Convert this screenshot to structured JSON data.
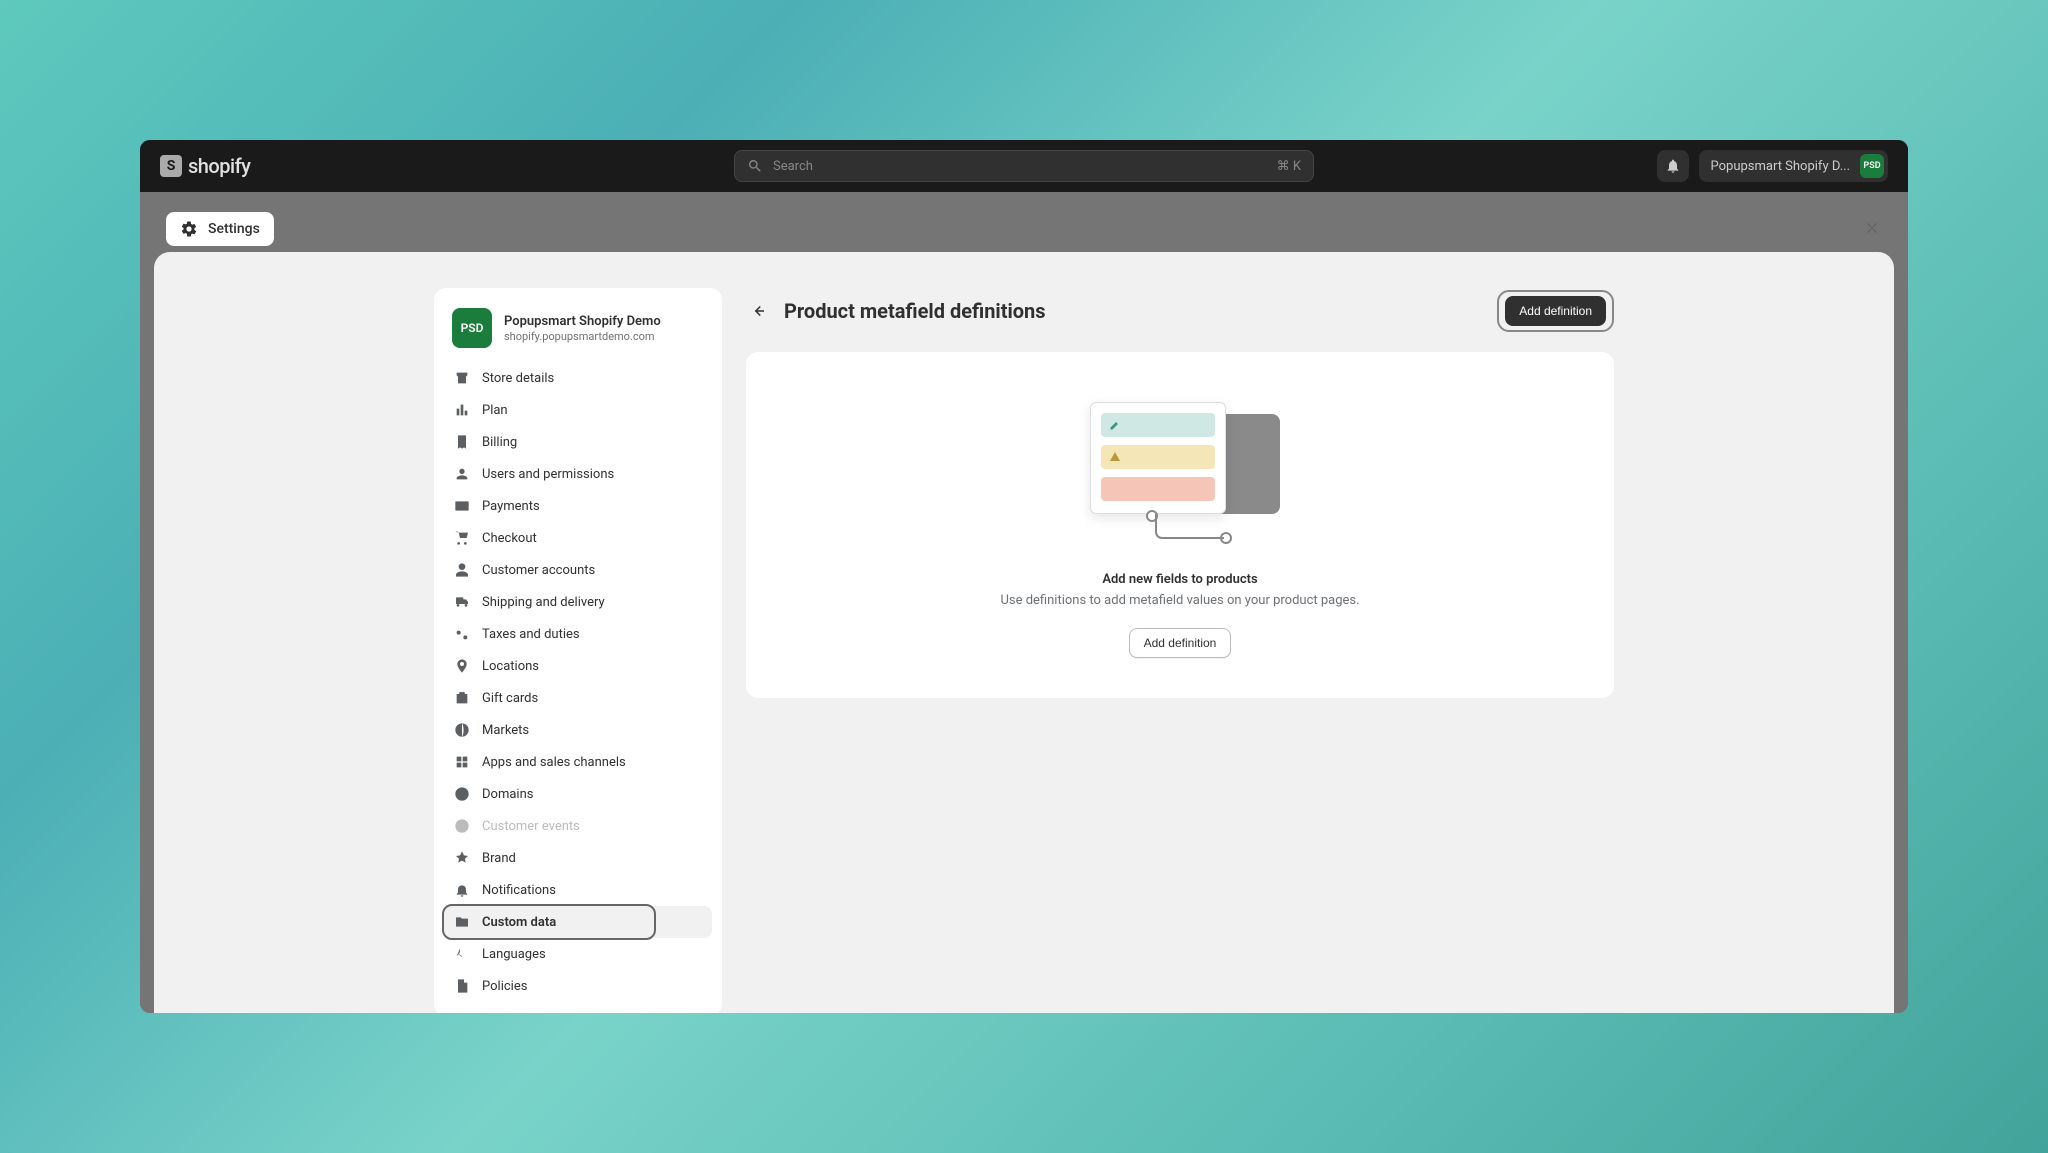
{
  "app": {
    "brand": "shopify"
  },
  "topbar": {
    "search_placeholder": "Search",
    "shortcut": "⌘ K",
    "profile_name": "Popupsmart Shopify D...",
    "profile_initials": "PSD"
  },
  "breadcrumb": {
    "label": "Settings"
  },
  "store": {
    "initials": "PSD",
    "name": "Popupsmart Shopify Demo",
    "domain": "shopify.popupsmartdemo.com"
  },
  "nav": {
    "items": [
      {
        "id": "store-details",
        "label": "Store details"
      },
      {
        "id": "plan",
        "label": "Plan"
      },
      {
        "id": "billing",
        "label": "Billing"
      },
      {
        "id": "users",
        "label": "Users and permissions"
      },
      {
        "id": "payments",
        "label": "Payments"
      },
      {
        "id": "checkout",
        "label": "Checkout"
      },
      {
        "id": "customer-accounts",
        "label": "Customer accounts"
      },
      {
        "id": "shipping",
        "label": "Shipping and delivery"
      },
      {
        "id": "taxes",
        "label": "Taxes and duties"
      },
      {
        "id": "locations",
        "label": "Locations"
      },
      {
        "id": "gift-cards",
        "label": "Gift cards"
      },
      {
        "id": "markets",
        "label": "Markets"
      },
      {
        "id": "apps",
        "label": "Apps and sales channels"
      },
      {
        "id": "domains",
        "label": "Domains"
      },
      {
        "id": "customer-events",
        "label": "Customer events"
      },
      {
        "id": "brand",
        "label": "Brand"
      },
      {
        "id": "notifications",
        "label": "Notifications"
      },
      {
        "id": "custom-data",
        "label": "Custom data"
      },
      {
        "id": "languages",
        "label": "Languages"
      },
      {
        "id": "policies",
        "label": "Policies"
      }
    ]
  },
  "panel": {
    "title": "Product metafield definitions",
    "add_button": "Add definition"
  },
  "empty": {
    "title": "Add new fields to products",
    "description": "Use definitions to add metafield values on your product pages.",
    "button": "Add definition"
  }
}
